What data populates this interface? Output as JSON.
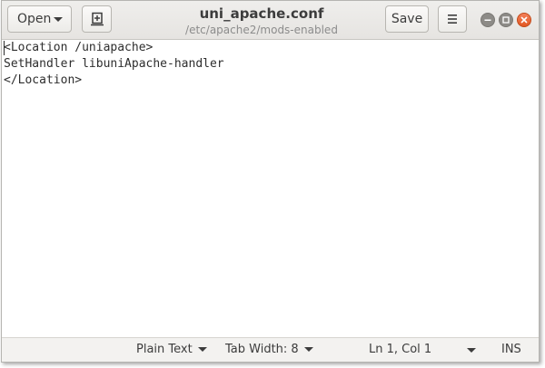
{
  "header": {
    "open_label": "Open",
    "save_label": "Save",
    "title": "uni_apache.conf",
    "subtitle": "/etc/apache2/mods-enabled",
    "icons": {
      "pin": "new-document-icon",
      "menu": "hamburger-menu-icon",
      "minimize": "minimize-icon",
      "maximize": "maximize-icon",
      "close": "close-icon"
    }
  },
  "editor": {
    "lines": [
      "<Location /uniapache>",
      "SetHandler libuniApache-handler",
      "</Location>"
    ]
  },
  "statusbar": {
    "language": "Plain Text",
    "tab_width": "Tab Width: 8",
    "position": "Ln 1, Col 1",
    "mode": "INS"
  },
  "colors": {
    "close_button": "#e25822",
    "headerbar": "#e8e6e3"
  }
}
